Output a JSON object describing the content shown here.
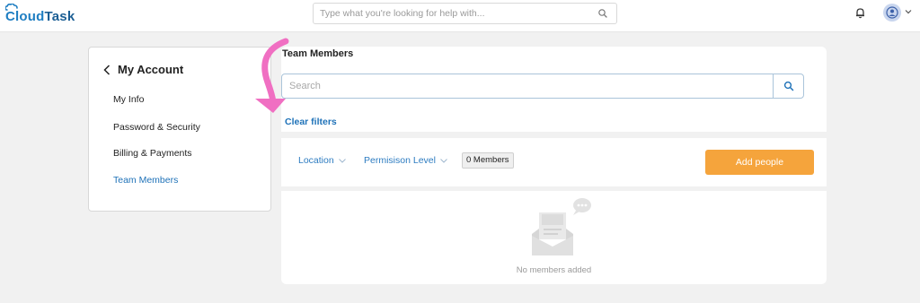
{
  "header": {
    "logo_text_1": "Cloud",
    "logo_text_2": "Task",
    "search_placeholder": "Type what you're looking for help with..."
  },
  "sidebar": {
    "title": "My Account",
    "items": [
      {
        "label": "My Info"
      },
      {
        "label": "Password & Security"
      },
      {
        "label": "Billing & Payments"
      },
      {
        "label": "Team Members",
        "active": true
      }
    ]
  },
  "main": {
    "title": "Team Members",
    "search_placeholder": "Search",
    "clear_filters": "Clear filters",
    "filters": {
      "location": "Location",
      "permission": "Permisison Level"
    },
    "member_count": "0 Members",
    "add_button": "Add people",
    "empty_text": "No members added"
  },
  "colors": {
    "accent": "#1f72b8",
    "button": "#f5a43c",
    "annotation_arrow": "#f06fc2"
  }
}
